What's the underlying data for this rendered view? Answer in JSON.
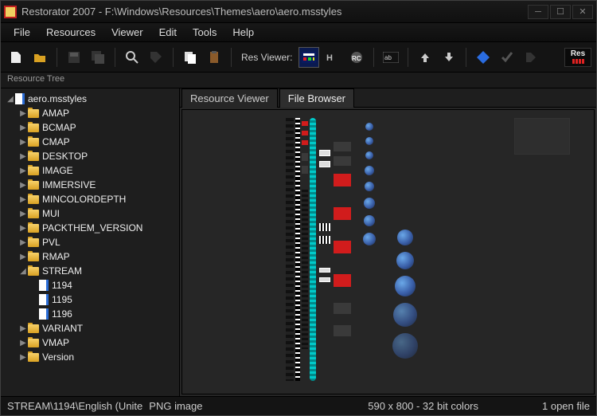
{
  "title": "Restorator 2007 - F:\\Windows\\Resources\\Themes\\aero\\aero.msstyles",
  "menus": [
    "File",
    "Resources",
    "Viewer",
    "Edit",
    "Tools",
    "Help"
  ],
  "toolbar": {
    "resViewerLabel": "Res Viewer:"
  },
  "treeHeader": "Resource Tree",
  "root": "aero.msstyles",
  "folders": [
    "AMAP",
    "BCMAP",
    "CMAP",
    "DESKTOP",
    "IMAGE",
    "IMMERSIVE",
    "MINCOLORDEPTH",
    "MUI",
    "PACKTHEM_VERSION",
    "PVL",
    "RMAP"
  ],
  "stream": {
    "label": "STREAM",
    "items": [
      "1194",
      "1195",
      "1196"
    ]
  },
  "folders2": [
    "VARIANT",
    "VMAP",
    "Version"
  ],
  "tabs": {
    "viewer": "Resource Viewer",
    "browser": "File Browser"
  },
  "status": {
    "path": "STREAM\\1194\\English (Unite",
    "type": "PNG image",
    "dims": "590 x 800 - 32 bit colors",
    "files": "1 open file"
  }
}
